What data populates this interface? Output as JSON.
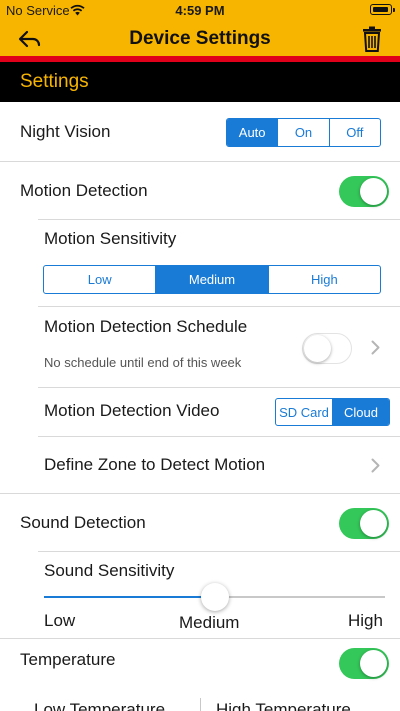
{
  "status_bar": {
    "carrier": "No Service",
    "time": "4:59 PM"
  },
  "nav": {
    "title": "Device Settings",
    "back_icon": "back-arrow-icon",
    "trash_icon": "trash-icon"
  },
  "colors": {
    "bar": "#f7b500",
    "accent_line": "#e0001a",
    "header_bg": "#000000",
    "header_text": "#f7b500",
    "segment": "#1a7bd6",
    "toggle_on": "#34c759"
  },
  "section": {
    "title": "Settings"
  },
  "night_vision": {
    "label": "Night Vision",
    "options": [
      "Auto",
      "On",
      "Off"
    ],
    "selected": "Auto"
  },
  "motion_detection": {
    "label": "Motion Detection",
    "enabled": true,
    "sensitivity": {
      "label": "Motion Sensitivity",
      "options": [
        "Low",
        "Medium",
        "High"
      ],
      "selected": "Medium"
    },
    "schedule": {
      "label": "Motion Detection Schedule",
      "subtitle": "No schedule until end of this week",
      "enabled": false
    },
    "video": {
      "label": "Motion Detection Video",
      "options": [
        "SD Card",
        "Cloud"
      ],
      "selected": "Cloud"
    },
    "zone": {
      "label": "Define Zone to Detect Motion"
    }
  },
  "sound_detection": {
    "label": "Sound Detection",
    "enabled": true,
    "sensitivity": {
      "label": "Sound Sensitivity",
      "min_label": "Low",
      "mid_label": "Medium",
      "max_label": "High",
      "value": 0.5
    }
  },
  "temperature": {
    "label": "Temperature",
    "enabled": true,
    "low_label": "Low Temperature",
    "high_label": "High Temperature"
  }
}
